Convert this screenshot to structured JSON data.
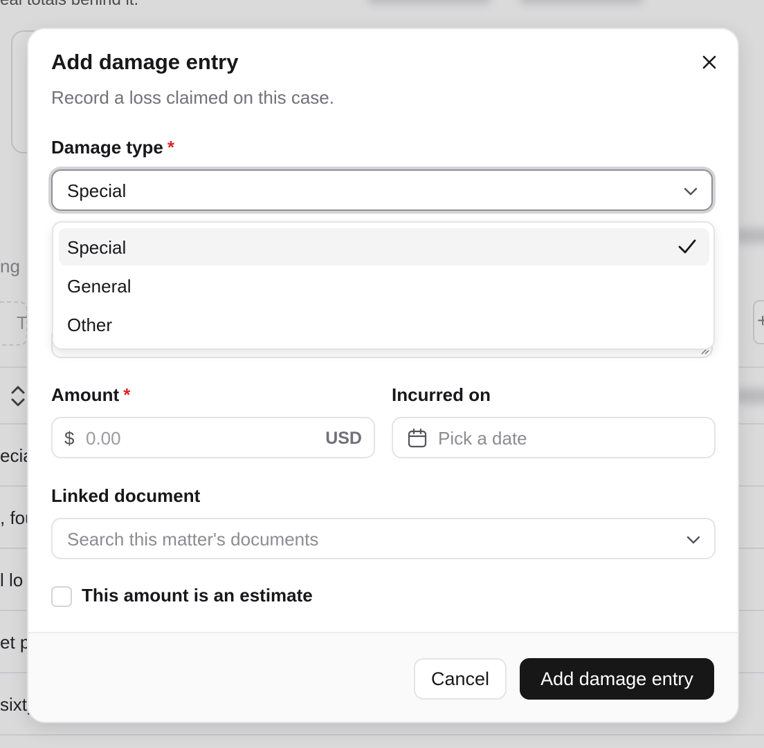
{
  "background": {
    "top_text": "eal totals behind it.",
    "section_label": "ng",
    "search_stub": "T",
    "table_cells": [
      "ecia",
      ", fou",
      "l lo",
      "et p",
      "sixty"
    ]
  },
  "dialog": {
    "title": "Add damage entry",
    "description": "Record a loss claimed on this case.",
    "close_icon": "close-icon"
  },
  "damage_type": {
    "label": "Damage type",
    "required_mark": "*",
    "selected_value": "Special",
    "options": [
      {
        "label": "Special",
        "selected": true
      },
      {
        "label": "General",
        "selected": false
      },
      {
        "label": "Other",
        "selected": false
      }
    ]
  },
  "amount": {
    "label": "Amount",
    "required_mark": "*",
    "currency_symbol": "$",
    "placeholder": "0.00",
    "currency_code": "USD"
  },
  "incurred_on": {
    "label": "Incurred on",
    "placeholder": "Pick a date"
  },
  "linked_document": {
    "label": "Linked document",
    "placeholder": "Search this matter's documents"
  },
  "estimate": {
    "label": "This amount is an estimate",
    "checked": false
  },
  "footer": {
    "cancel_label": "Cancel",
    "submit_label": "Add damage entry"
  },
  "colors": {
    "required": "#dc2626",
    "primary_button": "#171717",
    "muted_text": "#71717a"
  }
}
